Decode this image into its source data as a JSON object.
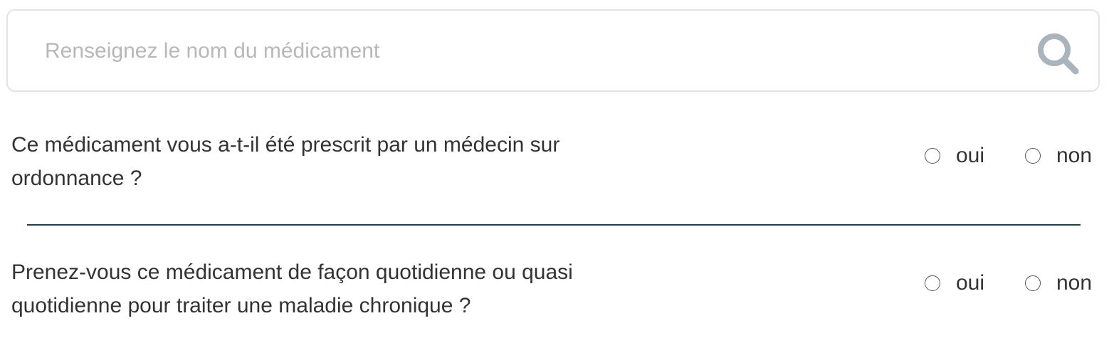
{
  "search": {
    "placeholder": "Renseignez le nom du médicament",
    "value": "",
    "icon": "search-icon"
  },
  "questions": [
    {
      "line1": "Ce médicament vous a-t-il été prescrit par un médecin sur",
      "line2": "ordonnance ?",
      "options": [
        "oui",
        "non"
      ],
      "selected": null
    },
    {
      "line1": "Prenez-vous ce médicament de façon quotidienne ou quasi",
      "line2": "quotidienne pour traiter une maladie chronique ?",
      "options": [
        "oui",
        "non"
      ],
      "selected": null
    }
  ],
  "colors": {
    "separator": "#1f3f4a",
    "search_icon": "#a9b4bd",
    "placeholder": "#b8b8b8"
  }
}
